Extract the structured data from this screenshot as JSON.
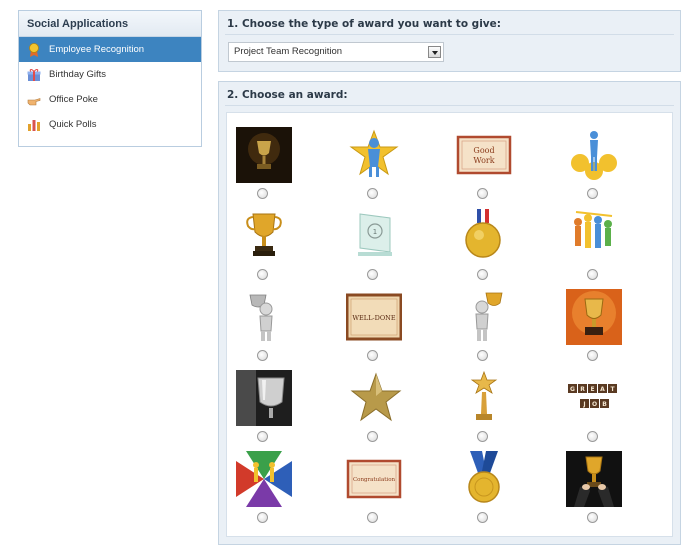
{
  "sidebar": {
    "title": "Social Applications",
    "items": [
      {
        "label": "Employee Recognition",
        "icon": "award-ribbon-icon",
        "active": true
      },
      {
        "label": "Birthday Gifts",
        "icon": "gift-icon",
        "active": false
      },
      {
        "label": "Office Poke",
        "icon": "pointing-hand-icon",
        "active": false
      },
      {
        "label": "Quick Polls",
        "icon": "bar-chart-icon",
        "active": false
      }
    ]
  },
  "step1": {
    "title": "1. Choose the type of award you want to give:",
    "selected": "Project Team Recognition"
  },
  "step2": {
    "title": "2. Choose an award:",
    "awards": [
      {
        "name": "dark-trophy-photo",
        "text": ""
      },
      {
        "name": "star-figure",
        "text": ""
      },
      {
        "name": "good-work-certificate",
        "text": "Good Work"
      },
      {
        "name": "team-star-figures",
        "text": ""
      },
      {
        "name": "gold-cup-trophy",
        "text": ""
      },
      {
        "name": "glass-plaque",
        "text": ""
      },
      {
        "name": "gold-medal",
        "text": ""
      },
      {
        "name": "team-figures-group",
        "text": ""
      },
      {
        "name": "figure-holding-trophy",
        "text": ""
      },
      {
        "name": "well-done-certificate",
        "text": "WELL-DONE"
      },
      {
        "name": "figure-with-cup",
        "text": ""
      },
      {
        "name": "trophy-orange-background",
        "text": ""
      },
      {
        "name": "silver-cup-photo",
        "text": ""
      },
      {
        "name": "gold-star",
        "text": ""
      },
      {
        "name": "star-statuette",
        "text": ""
      },
      {
        "name": "great-job-blocks",
        "text": "GREAT JOB"
      },
      {
        "name": "puzzle-figures",
        "text": ""
      },
      {
        "name": "congratulation-certificate",
        "text": "Congratulation"
      },
      {
        "name": "blue-ribbon-medal",
        "text": ""
      },
      {
        "name": "hands-holding-trophy",
        "text": ""
      }
    ]
  },
  "colors": {
    "accent": "#3d84c0",
    "panel_bg": "#eaf0f6",
    "border": "#c5d4e2"
  }
}
